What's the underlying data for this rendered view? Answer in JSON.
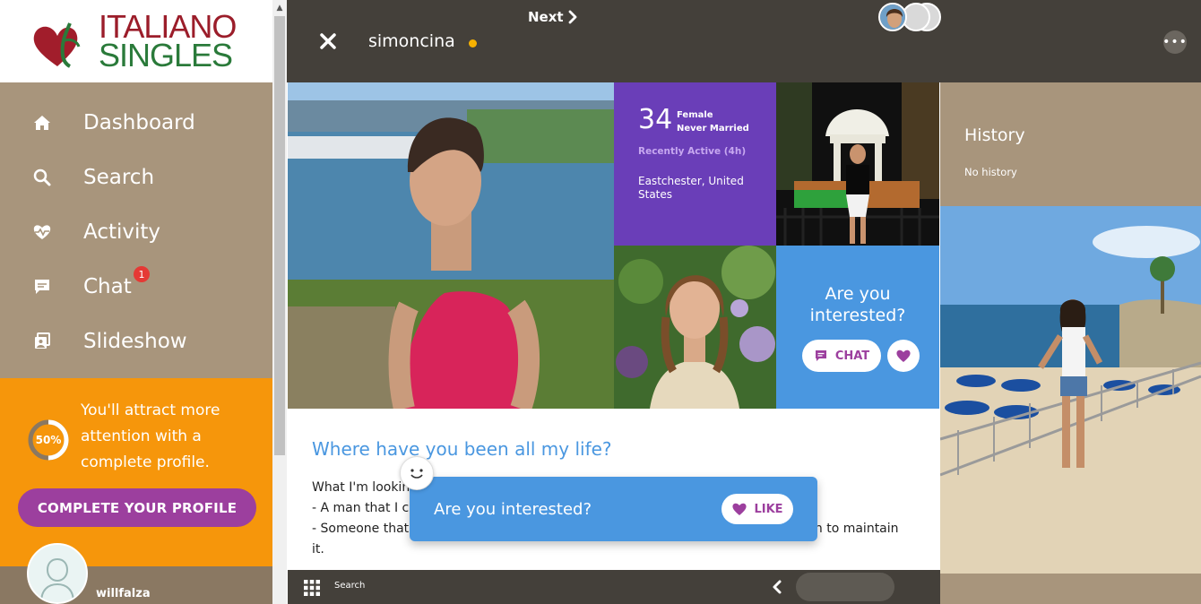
{
  "logo": {
    "line1": "ITALIANO",
    "line2": "SINGLES"
  },
  "sidebar": {
    "items": [
      {
        "label": "Dashboard",
        "icon": "home-icon"
      },
      {
        "label": "Search",
        "icon": "search-icon"
      },
      {
        "label": "Activity",
        "icon": "heartbeat-icon"
      },
      {
        "label": "Chat",
        "icon": "chat-icon",
        "badge": "1"
      },
      {
        "label": "Slideshow",
        "icon": "slideshow-icon"
      }
    ],
    "promo": {
      "progress_label": "50%",
      "progress": 0.5,
      "text": "You'll attract more attention with a complete profile.",
      "button": "COMPLETE YOUR PROFILE"
    },
    "user": {
      "name": "willfalza"
    }
  },
  "header": {
    "name": "simoncina"
  },
  "profile": {
    "age": "34",
    "gender": "Female",
    "status": "Never Married",
    "activity": "Recently Active (4h)",
    "location": "Eastchester, United States",
    "interest": {
      "question": "Are you interested?",
      "chat_label": "CHAT"
    }
  },
  "history": {
    "title": "History",
    "empty": "No history"
  },
  "about": {
    "title": "Where have you been all my life?",
    "line1": "What I'm looking",
    "line2": "- A man that I ca",
    "line3": "- Someone that i",
    "line3_end": "gh to maintain",
    "line4": "it."
  },
  "popup": {
    "question": "Are you interested?",
    "like_label": "LIKE"
  },
  "bottombar": {
    "search_label": "Search",
    "next_label": "Next"
  },
  "colors": {
    "sidebar": "#a8957c",
    "header": "#44403a",
    "promo": "#f6960b",
    "accent_purple": "#9c3f9e",
    "info_purple": "#6a3eb8",
    "interest_blue": "#4a97e0"
  }
}
